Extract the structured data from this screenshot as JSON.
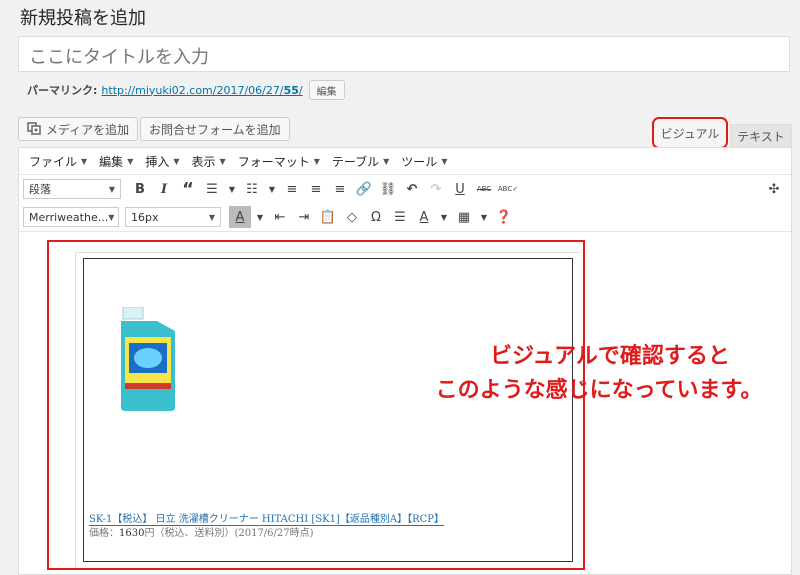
{
  "page": {
    "title": "新規投稿を追加"
  },
  "title_field": {
    "placeholder": "ここにタイトルを入力"
  },
  "permalink": {
    "label": "パーマリンク:",
    "url_base": "http://miyuki02.com/2017/06/27/",
    "slug": "55",
    "suffix": "/",
    "edit_label": "編集"
  },
  "media": {
    "add_media_label": "メディアを追加",
    "add_form_label": "お問合せフォームを追加"
  },
  "tabs": {
    "visual": "ビジュアル",
    "text": "テキスト"
  },
  "menubar": [
    "ファイル",
    "編集",
    "挿入",
    "表示",
    "フォーマット",
    "テーブル",
    "ツール"
  ],
  "toolbar": {
    "format_select": "段落",
    "font_select": "Merriweathe...",
    "size_select": "16px",
    "icons_row1": [
      "bold-icon",
      "italic-icon",
      "quote-icon",
      "bullet-list-icon",
      "numbered-list-icon",
      "align-left-icon",
      "align-center-icon",
      "align-right-icon",
      "link-icon",
      "unlink-icon",
      "undo-icon",
      "redo-icon",
      "underline-icon",
      "strikethrough-icon",
      "spellcheck-icon",
      "fullscreen-icon"
    ],
    "icons_row2": [
      "text-color-icon",
      "outdent-icon",
      "indent-icon",
      "paste-text-icon",
      "clear-format-icon",
      "special-char-icon",
      "horizontal-rule-icon",
      "background-color-icon",
      "table-icon",
      "help-icon"
    ]
  },
  "content": {
    "product_link": "SK-1【税込】 日立 洗濯槽クリーナー HITACHI [SK1]【返品種別A】【RCP】",
    "price_label": "価格：",
    "price_value": "1630",
    "price_suffix": "円（税込、送料別）(2017/6/27時点)"
  },
  "annotation": {
    "line1": "ビジュアルで確認すると",
    "line2": "このような感じになっています。"
  },
  "colors": {
    "accent_red": "#e01b1b",
    "link_blue": "#0073aa",
    "bottle": "#3bbfcf"
  }
}
